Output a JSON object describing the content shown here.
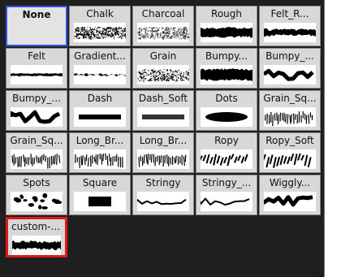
{
  "brush_panel": {
    "tiles": [
      {
        "label": "None",
        "stroke": "none"
      },
      {
        "label": "Chalk",
        "stroke": "chalk"
      },
      {
        "label": "Charcoal",
        "stroke": "charcoal"
      },
      {
        "label": "Rough",
        "stroke": "rough"
      },
      {
        "label": "Felt_R...",
        "stroke": "felt-rough"
      },
      {
        "label": "Felt",
        "stroke": "felt"
      },
      {
        "label": "Gradient...",
        "stroke": "gradient"
      },
      {
        "label": "Grain",
        "stroke": "grain"
      },
      {
        "label": "Bumpy...",
        "stroke": "bumpy-thick"
      },
      {
        "label": "Bumpy_...",
        "stroke": "bumpy-zigzag"
      },
      {
        "label": "Bumpy_...",
        "stroke": "bumpy-zigzag"
      },
      {
        "label": "Dash",
        "stroke": "dash"
      },
      {
        "label": "Dash_Soft",
        "stroke": "dash-soft"
      },
      {
        "label": "Dots",
        "stroke": "dots"
      },
      {
        "label": "Grain_Sq...",
        "stroke": "grain-square"
      },
      {
        "label": "Grain_Sq...",
        "stroke": "grain-square-2"
      },
      {
        "label": "Long_Br...",
        "stroke": "long-bristle"
      },
      {
        "label": "Long_Br...",
        "stroke": "long-bristle-2"
      },
      {
        "label": "Ropy",
        "stroke": "ropy"
      },
      {
        "label": "Ropy_Soft",
        "stroke": "ropy-soft"
      },
      {
        "label": "Spots",
        "stroke": "spots"
      },
      {
        "label": "Square",
        "stroke": "square"
      },
      {
        "label": "Stringy",
        "stroke": "stringy"
      },
      {
        "label": "Stringy_...",
        "stroke": "stringy-2"
      },
      {
        "label": "Wiggly...",
        "stroke": "wiggly"
      },
      {
        "label": "custom-...",
        "stroke": "custom"
      }
    ],
    "colors": {
      "selected_border": "#2f56e0",
      "highlight_border": "#e01818"
    }
  }
}
